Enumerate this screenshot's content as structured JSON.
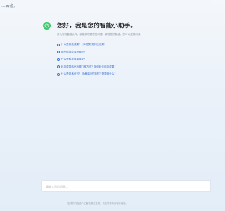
{
  "header": {
    "brand": "...云道。"
  },
  "assistant": {
    "title": "您好，我是您的智能小助手。",
    "intro": "作为您的智能伙伴，我能够理解您的问题，解答您的疑惑。您可以这样问我："
  },
  "suggestions": [
    "什么是科技成果？什么是职务科技成果？",
    "哪些科技成果有哪些？",
    "什么是科技成果转化？",
    "科技成果转化有哪几种方式？如何转化科技成果？",
    "什么是技术许可？技术转让的流程？需要做什么？"
  ],
  "input": {
    "placeholder": "请输入您的问题..."
  },
  "footer": {
    "disclaimer": "生成的内容由人工智能模型生成，请注意核实内容准确性。"
  },
  "colors": {
    "accent": "#3a73d8",
    "logo": "#3ec96c"
  }
}
